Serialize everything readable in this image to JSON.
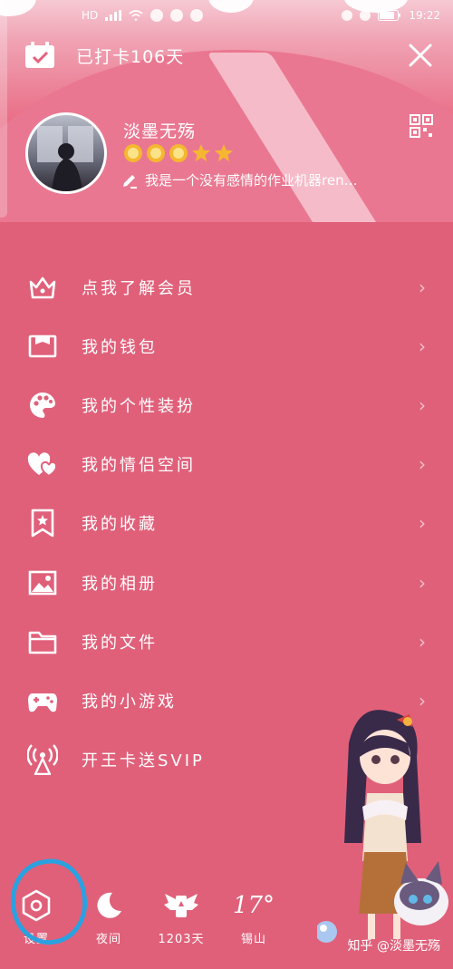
{
  "status_bar": {
    "carrier": "HD",
    "right_text": "19:22"
  },
  "header": {
    "checkin_text": "已打卡106天"
  },
  "profile": {
    "nickname": "淡墨无殇",
    "signature": "我是一个没有感情的作业机器ren…",
    "level_icons": [
      "sun-icon",
      "sun-icon",
      "sun-icon",
      "star-icon",
      "star-icon"
    ]
  },
  "menu": {
    "items": [
      {
        "label": "点我了解会员",
        "icon": "crown-icon",
        "has_chevron": true
      },
      {
        "label": "我的钱包",
        "icon": "wallet-icon",
        "has_chevron": true
      },
      {
        "label": "我的个性装扮",
        "icon": "palette-icon",
        "has_chevron": true
      },
      {
        "label": "我的情侣空间",
        "icon": "hearts-icon",
        "has_chevron": true
      },
      {
        "label": "我的收藏",
        "icon": "bookmark-star-icon",
        "has_chevron": true
      },
      {
        "label": "我的相册",
        "icon": "image-icon",
        "has_chevron": true
      },
      {
        "label": "我的文件",
        "icon": "folder-icon",
        "has_chevron": true
      },
      {
        "label": "我的小游戏",
        "icon": "gamepad-icon",
        "has_chevron": true
      },
      {
        "label": "开王卡送SVIP",
        "icon": "signal-tower-icon",
        "has_chevron": false
      }
    ]
  },
  "bottom_bar": {
    "settings": "设置",
    "night": "夜间",
    "days": "1203天",
    "temperature": "17°",
    "city": "锡山"
  },
  "watermark": "知乎 @淡墨无殇",
  "colors": {
    "background": "#e0607a",
    "highlight": "#2aa1e0",
    "sun": "#f5b731"
  }
}
